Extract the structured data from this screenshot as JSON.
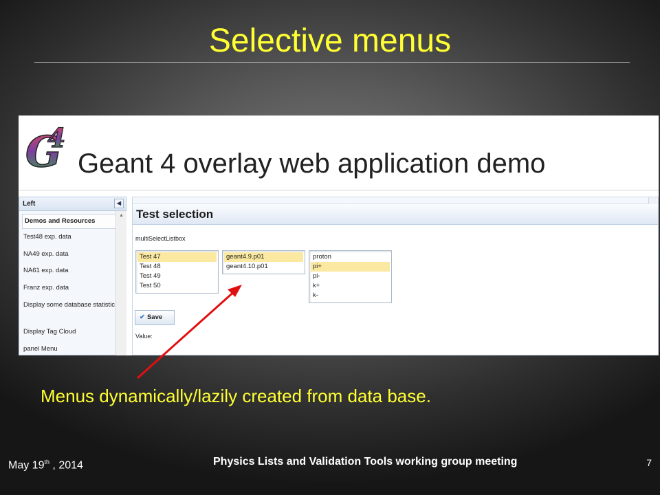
{
  "slide": {
    "title": "Selective menus",
    "caption": "Menus dynamically/lazily created from data base.",
    "footer": {
      "date_prefix": "May 19",
      "date_sup": "th",
      "date_suffix": " , 2014",
      "meeting": "Physics Lists and Validation Tools working group meeting",
      "page": "7"
    },
    "colors": {
      "title": "#ffff33",
      "arrow": "#e01010"
    }
  },
  "app": {
    "logo_icon": "g4-logo",
    "title": "Geant 4 overlay web application demo",
    "left_panel": {
      "header": "Left",
      "collapse_icon": "chevron-left-icon",
      "items": [
        "Demos and Resources",
        "Test48 exp. data",
        "NA49 exp. data",
        "NA61 exp. data",
        "Franz exp. data",
        "Display some database statistic",
        "Display Tag Cloud",
        "panel Menu"
      ]
    },
    "main": {
      "header": "Test selection",
      "listbox_label": "multiSelectListbox",
      "listbox_tests": [
        "Test 47",
        "Test 48",
        "Test 49",
        "Test 50"
      ],
      "listbox_versions": [
        "geant4.9.p01",
        "geant4.10.p01"
      ],
      "listbox_particles": [
        "proton",
        "pi+",
        "pi-",
        "k+",
        "k-"
      ],
      "selected": {
        "tests": "Test 47",
        "versions": "geant4.9.p01",
        "particles": "pi+"
      },
      "save_label": "Save",
      "value_label": "Value:"
    }
  }
}
